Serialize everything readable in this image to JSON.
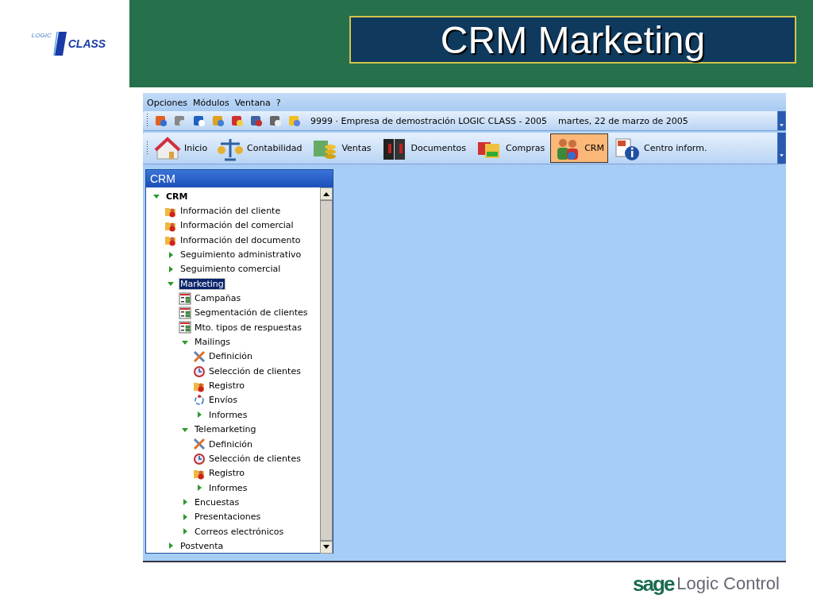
{
  "slide": {
    "logo": {
      "top": "LOGIC",
      "bottom": "CLASS"
    },
    "title": "CRM Marketing",
    "footer_logo": {
      "brand": "sage",
      "name": "Logic Control"
    }
  },
  "window": {
    "menu": [
      "Opciones",
      "Módulos",
      "Ventana",
      "?"
    ],
    "info_bar": {
      "company": "9999 · Empresa de demostración LOGIC CLASS - 2005",
      "date": "martes, 22 de marzo de 2005"
    },
    "modules": [
      {
        "label": "Inicio",
        "kind": "house",
        "selected": false
      },
      {
        "label": "Contabilidad",
        "kind": "scale",
        "selected": false
      },
      {
        "label": "Ventas",
        "kind": "coins",
        "selected": false
      },
      {
        "label": "Documentos",
        "kind": "binders",
        "selected": false
      },
      {
        "label": "Compras",
        "kind": "boxes",
        "selected": false
      },
      {
        "label": "CRM",
        "kind": "people",
        "selected": true
      },
      {
        "label": "Centro inform.",
        "kind": "info",
        "selected": false
      }
    ],
    "panel": {
      "title": "CRM",
      "tree": [
        {
          "label": "CRM",
          "kind": "branch",
          "expanded": true,
          "selected": false,
          "children": [
            {
              "label": "Información del cliente",
              "kind": "folder",
              "selected": false
            },
            {
              "label": "Información del comercial",
              "kind": "folder",
              "selected": false
            },
            {
              "label": "Información del documento",
              "kind": "folder",
              "selected": false
            },
            {
              "label": "Seguimiento administrativo",
              "kind": "branch",
              "expanded": false,
              "selected": false
            },
            {
              "label": "Seguimiento comercial",
              "kind": "branch",
              "expanded": false,
              "selected": false
            },
            {
              "label": "Marketing",
              "kind": "branch",
              "expanded": true,
              "selected": true,
              "children": [
                {
                  "label": "Campañas",
                  "kind": "list",
                  "selected": false
                },
                {
                  "label": "Segmentación de clientes",
                  "kind": "list",
                  "selected": false
                },
                {
                  "label": "Mto. tipos de respuestas",
                  "kind": "list",
                  "selected": false
                },
                {
                  "label": "Mailings",
                  "kind": "branch",
                  "expanded": true,
                  "selected": false,
                  "children": [
                    {
                      "label": "Definición",
                      "kind": "tools",
                      "selected": false
                    },
                    {
                      "label": "Selección de clientes",
                      "kind": "clock",
                      "selected": false
                    },
                    {
                      "label": "Registro",
                      "kind": "folder",
                      "selected": false
                    },
                    {
                      "label": "Envíos",
                      "kind": "cycle",
                      "selected": false
                    },
                    {
                      "label": "Informes",
                      "kind": "branch",
                      "expanded": false,
                      "selected": false
                    }
                  ]
                },
                {
                  "label": "Telemarketing",
                  "kind": "branch",
                  "expanded": true,
                  "selected": false,
                  "children": [
                    {
                      "label": "Definición",
                      "kind": "tools",
                      "selected": false
                    },
                    {
                      "label": "Selección de clientes",
                      "kind": "clock",
                      "selected": false
                    },
                    {
                      "label": "Registro",
                      "kind": "folder",
                      "selected": false
                    },
                    {
                      "label": "Informes",
                      "kind": "branch",
                      "expanded": false,
                      "selected": false
                    }
                  ]
                },
                {
                  "label": "Encuestas",
                  "kind": "branch",
                  "expanded": false,
                  "selected": false
                },
                {
                  "label": "Presentaciones",
                  "kind": "branch",
                  "expanded": false,
                  "selected": false
                },
                {
                  "label": "Correos electrónicos",
                  "kind": "branch",
                  "expanded": false,
                  "selected": false
                }
              ]
            },
            {
              "label": "Postventa",
              "kind": "branch",
              "expanded": false,
              "selected": false
            }
          ]
        }
      ]
    }
  }
}
